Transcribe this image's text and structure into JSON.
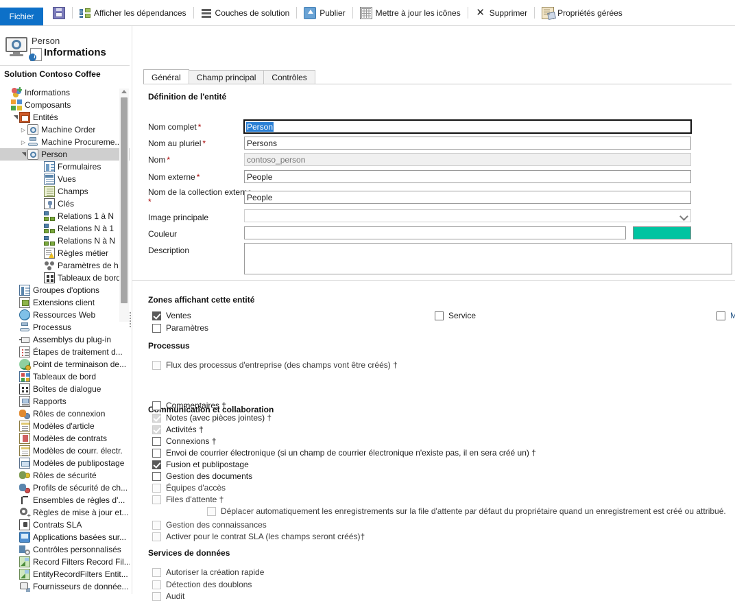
{
  "toolbar": {
    "file_label": "Fichier",
    "items": [
      {
        "label": "",
        "icon": "save-icon",
        "name": "save"
      },
      {
        "label": "Afficher les dépendances",
        "icon": "dependencies-icon",
        "name": "show-dependencies"
      },
      {
        "label": "Couches de solution",
        "icon": "solution-layers-icon",
        "name": "solution-layers"
      },
      {
        "label": "Publier",
        "icon": "publish-icon",
        "name": "publish"
      },
      {
        "label": "Mettre à jour les icônes",
        "icon": "update-icons-icon",
        "name": "update-icons"
      },
      {
        "label": "Supprimer",
        "icon": "delete-icon",
        "name": "delete"
      },
      {
        "label": "Propriétés gérées",
        "icon": "managed-properties-icon",
        "name": "managed-properties"
      }
    ]
  },
  "entity_header": {
    "entity_label": "Person",
    "page_title": "Informations"
  },
  "solution": {
    "name": "Solution Contoso Coffee"
  },
  "tree": [
    {
      "label": "Informations",
      "indent": 0,
      "icon": "informations-icon",
      "expander": "",
      "selected": false
    },
    {
      "label": "Composants",
      "indent": 0,
      "icon": "components-icon",
      "expander": "",
      "selected": false
    },
    {
      "label": "Entités",
      "indent": 1,
      "icon": "entities-icon",
      "expander": "expanded",
      "selected": false
    },
    {
      "label": "Machine Order",
      "indent": 2,
      "icon": "entity-icon",
      "expander": "collapsed",
      "selected": false
    },
    {
      "label": "Machine Procureme...",
      "indent": 2,
      "icon": "process-entity-icon",
      "expander": "collapsed",
      "selected": false
    },
    {
      "label": "Person",
      "indent": 2,
      "icon": "entity-icon",
      "expander": "expanded",
      "selected": true
    },
    {
      "label": "Formulaires",
      "indent": 4,
      "icon": "forms-icon",
      "expander": "",
      "selected": false
    },
    {
      "label": "Vues",
      "indent": 4,
      "icon": "views-icon",
      "expander": "",
      "selected": false
    },
    {
      "label": "Champs",
      "indent": 4,
      "icon": "fields-icon",
      "expander": "",
      "selected": false
    },
    {
      "label": "Clés",
      "indent": 4,
      "icon": "keys-icon",
      "expander": "",
      "selected": false
    },
    {
      "label": "Relations 1 à N",
      "indent": 4,
      "icon": "relationship-1n-icon",
      "expander": "",
      "selected": false
    },
    {
      "label": "Relations N à 1",
      "indent": 4,
      "icon": "relationship-n1-icon",
      "expander": "",
      "selected": false
    },
    {
      "label": "Relations N à N",
      "indent": 4,
      "icon": "relationship-nn-icon",
      "expander": "",
      "selected": false
    },
    {
      "label": "Règles métier",
      "indent": 4,
      "icon": "business-rules-icon",
      "expander": "",
      "selected": false
    },
    {
      "label": "Paramètres de h...",
      "indent": 4,
      "icon": "hierarchy-settings-icon",
      "expander": "",
      "selected": false
    },
    {
      "label": "Tableaux de bord",
      "indent": 4,
      "icon": "dashboards-icon",
      "expander": "",
      "selected": false
    },
    {
      "label": "Groupes d'options",
      "indent": 1,
      "icon": "option-sets-icon",
      "expander": "",
      "selected": false
    },
    {
      "label": "Extensions client",
      "indent": 1,
      "icon": "client-extensions-icon",
      "expander": "",
      "selected": false
    },
    {
      "label": "Ressources Web",
      "indent": 1,
      "icon": "web-resources-icon",
      "expander": "",
      "selected": false
    },
    {
      "label": "Processus",
      "indent": 1,
      "icon": "processes-icon",
      "expander": "",
      "selected": false
    },
    {
      "label": "Assemblys du plug-in",
      "indent": 1,
      "icon": "plugin-assemblies-icon",
      "expander": "",
      "selected": false
    },
    {
      "label": "Étapes de traitement d...",
      "indent": 1,
      "icon": "sdk-steps-icon",
      "expander": "",
      "selected": false
    },
    {
      "label": "Point de terminaison de...",
      "indent": 1,
      "icon": "service-endpoint-icon",
      "expander": "",
      "selected": false
    },
    {
      "label": "Tableaux de bord",
      "indent": 1,
      "icon": "dashboards-main-icon",
      "expander": "",
      "selected": false
    },
    {
      "label": "Boîtes de dialogue",
      "indent": 1,
      "icon": "dialogs-icon",
      "expander": "",
      "selected": false
    },
    {
      "label": "Rapports",
      "indent": 1,
      "icon": "reports-icon",
      "expander": "",
      "selected": false
    },
    {
      "label": "Rôles de connexion",
      "indent": 1,
      "icon": "connection-roles-icon",
      "expander": "",
      "selected": false
    },
    {
      "label": "Modèles d'article",
      "indent": 1,
      "icon": "article-templates-icon",
      "expander": "",
      "selected": false
    },
    {
      "label": "Modèles de contrats",
      "indent": 1,
      "icon": "contract-templates-icon",
      "expander": "",
      "selected": false
    },
    {
      "label": "Modèles de courr. électr.",
      "indent": 1,
      "icon": "email-templates-icon",
      "expander": "",
      "selected": false
    },
    {
      "label": "Modèles de publipostage",
      "indent": 1,
      "icon": "mail-merge-templates-icon",
      "expander": "",
      "selected": false
    },
    {
      "label": "Rôles de sécurité",
      "indent": 1,
      "icon": "security-roles-icon",
      "expander": "",
      "selected": false
    },
    {
      "label": "Profils de sécurité de ch...",
      "indent": 1,
      "icon": "field-security-profiles-icon",
      "expander": "",
      "selected": false
    },
    {
      "label": "Ensembles de règles d'...",
      "indent": 1,
      "icon": "rule-sets-icon",
      "expander": "",
      "selected": false
    },
    {
      "label": "Règles de mise à jour et...",
      "indent": 1,
      "icon": "update-rules-icon",
      "expander": "",
      "selected": false
    },
    {
      "label": "Contrats SLA",
      "indent": 1,
      "icon": "sla-icon",
      "expander": "",
      "selected": false
    },
    {
      "label": "Applications basées sur...",
      "indent": 1,
      "icon": "model-driven-apps-icon",
      "expander": "",
      "selected": false
    },
    {
      "label": "Contrôles personnalisés",
      "indent": 1,
      "icon": "custom-controls-icon",
      "expander": "",
      "selected": false
    },
    {
      "label": "Record Filters Record Fil...",
      "indent": 1,
      "icon": "record-filters-icon",
      "expander": "",
      "selected": false
    },
    {
      "label": "EntityRecordFilters Entit...",
      "indent": 1,
      "icon": "entity-record-filters-icon",
      "expander": "",
      "selected": false
    },
    {
      "label": "Fournisseurs de donnée...",
      "indent": 1,
      "icon": "data-providers-icon",
      "expander": "",
      "selected": false
    }
  ],
  "tabs": [
    {
      "label": "Général",
      "active": true
    },
    {
      "label": "Champ principal",
      "active": false
    },
    {
      "label": "Contrôles",
      "active": false
    }
  ],
  "sections": {
    "entity_definition": "Définition de l'entité",
    "areas": "Zones affichant cette entité",
    "process": "Processus",
    "communication": "Communication et collaboration",
    "data_services": "Services de données"
  },
  "fields": {
    "display_name": {
      "label": "Nom complet",
      "value": "Person",
      "required": true,
      "focused": true
    },
    "plural_name": {
      "label": "Nom au pluriel",
      "value": "Persons",
      "required": true
    },
    "name": {
      "label": "Nom",
      "value": "contoso_person",
      "required": true,
      "readonly": true
    },
    "external_name": {
      "label": "Nom externe",
      "value": "People",
      "required": true
    },
    "external_collection_name": {
      "label": "Nom de la collection externe",
      "value": "People",
      "required": true
    },
    "primary_image": {
      "label": "Image principale",
      "value": "",
      "required": false
    },
    "color": {
      "label": "Couleur",
      "value": "",
      "swatch": "#00C4A1",
      "required": false
    },
    "description": {
      "label": "Description",
      "value": "",
      "required": false
    }
  },
  "areas": [
    {
      "label": "Ventes",
      "checked": true,
      "disabled": false
    },
    {
      "label": "Paramètres",
      "checked": false,
      "disabled": false
    },
    {
      "label": "Service",
      "checked": false,
      "disabled": false
    },
    {
      "label": "M",
      "checked": false,
      "disabled": false
    }
  ],
  "process_options": [
    {
      "label": "Flux des processus d'entreprise (des champs vont être créés) †",
      "checked": false,
      "disabled": true
    }
  ],
  "communication_options": [
    {
      "label": "Commentaires †",
      "checked": false,
      "disabled": false
    },
    {
      "label": "Notes (avec pièces jointes) †",
      "checked": true,
      "disabled": true
    },
    {
      "label": "Activités †",
      "checked": true,
      "disabled": true
    },
    {
      "label": "Connexions †",
      "checked": false,
      "disabled": false
    },
    {
      "label": "Envoi de courrier électronique (si un champ de courrier électronique n'existe pas, il en sera créé un) †",
      "checked": false,
      "disabled": false
    },
    {
      "label": "Fusion et publipostage",
      "checked": true,
      "disabled": false
    },
    {
      "label": "Gestion des documents",
      "checked": false,
      "disabled": false
    },
    {
      "label": "Équipes d'accès",
      "checked": false,
      "disabled": true
    },
    {
      "label": "Files d'attente †",
      "checked": false,
      "disabled": true
    }
  ],
  "queue_sub_option": {
    "label": "Déplacer automatiquement les enregistrements sur la file d'attente par défaut du propriétaire quand un enregistrement est créé ou attribué.",
    "checked": false,
    "disabled": true
  },
  "communication_options_2": [
    {
      "label": "Gestion des connaissances",
      "checked": false,
      "disabled": true
    },
    {
      "label": "Activer pour le contrat SLA (les champs seront créés)†",
      "checked": false,
      "disabled": true
    }
  ],
  "data_service_options": [
    {
      "label": "Autoriser la création rapide",
      "checked": false,
      "disabled": true
    },
    {
      "label": "Détection des doublons",
      "checked": false,
      "disabled": true
    },
    {
      "label": "Audit",
      "checked": false,
      "disabled": true
    }
  ]
}
